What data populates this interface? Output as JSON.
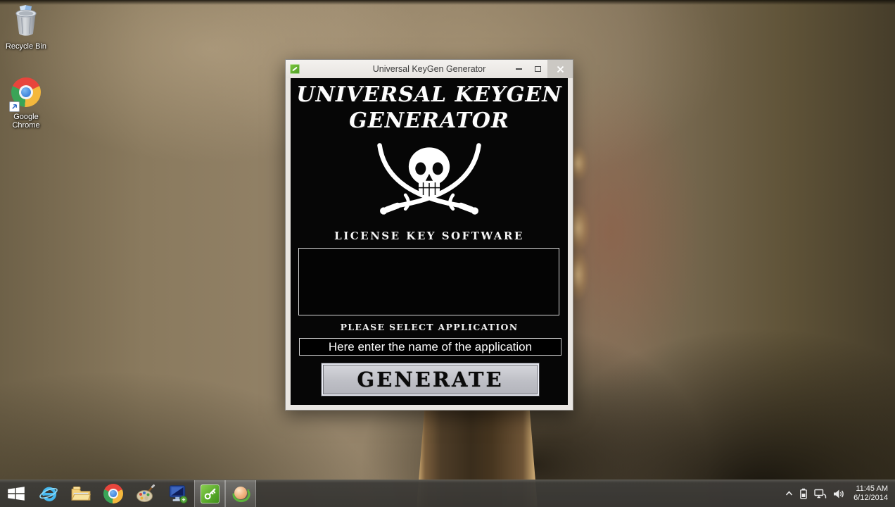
{
  "desktop": {
    "icons": [
      {
        "id": "recycle-bin",
        "label": "Recycle Bin"
      },
      {
        "id": "google-chrome",
        "label": "Google Chrome"
      }
    ]
  },
  "window": {
    "title": "Universal KeyGen Generator",
    "heading_line1": "UNIVERSAL KEYGEN",
    "heading_line2": "GENERATOR",
    "tagline": "LICENSE KEY SOFTWARE",
    "select_prompt": "PLEASE SELECT APPLICATION",
    "app_name_input": {
      "value": "Here enter the name of the application"
    },
    "generate_label": "GENERATE"
  },
  "taskbar": {
    "tray": {
      "time": "11:45 AM",
      "date": "6/12/2014"
    }
  },
  "icons": {
    "titlebar": "keygen-app-icon",
    "window_art": "skull-crossed-swords-icon",
    "taskbar": [
      "windows-start-icon",
      "internet-explorer-icon",
      "file-explorer-icon",
      "chrome-icon",
      "paint-palette-icon",
      "computer-icon",
      "keygen-key-icon",
      "orange-sphere-icon"
    ],
    "tray": [
      "hidden-icons-chevron-icon",
      "battery-icon",
      "network-icon",
      "volume-icon"
    ]
  },
  "colors": {
    "keygen_green": "#57a829",
    "titlebar_bg": "#e9e6e2",
    "content_bg": "#060606",
    "button_face": "#bebfc6",
    "taskbar_bg": "#3a3834"
  }
}
